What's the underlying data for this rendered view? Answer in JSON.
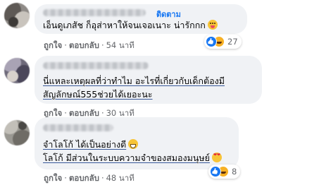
{
  "comments": [
    {
      "follow_label": "ติดตาม",
      "lines": [
        "เอ็นดูเภสัช ก็อุส่าหาให้จนเจอเนาะ น่ารักกก"
      ],
      "emoji": "grinning-face-icon",
      "reaction_count": "27",
      "reaction_icons": [
        "like-icon",
        "haha-icon"
      ],
      "like_label": "ถูกใจ",
      "reply_label": "ตอบกลับ",
      "time": "54 นาที"
    },
    {
      "lines": [
        "นี่แหละเหตุผลที่ว่าทำไม อะไรที่เกี่ยวกับเด็กต้องมี",
        "สัญลักษณ์555ช่วยได้เยอะนะ"
      ],
      "like_label": "ถูกใจ",
      "reply_label": "ตอบกลับ",
      "time": "30 นาที"
    },
    {
      "lines": [
        "จำโลโก้ ได้เป็นอย่างดี",
        "โลโก้ มีส่วนในระบบความจำของสมองมนุษย์"
      ],
      "emojis": [
        "grinning-face-icon",
        "heart-eyes-face-icon"
      ],
      "reaction_count": "8",
      "reaction_icons": [
        "like-icon",
        "haha-icon"
      ],
      "like_label": "ถูกใจ",
      "reply_label": "ตอบกลับ",
      "time": "48 นาที"
    }
  ],
  "colors": {
    "bubble": "#f0f2f5",
    "text": "#050505",
    "meta": "#65676b",
    "link": "#1877f2"
  }
}
